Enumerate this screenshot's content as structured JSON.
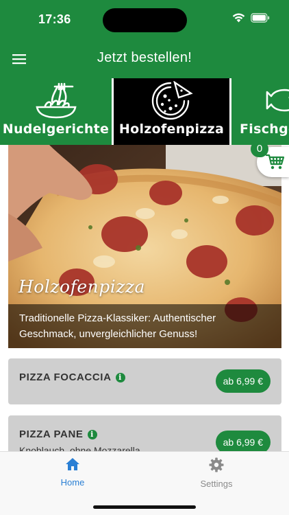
{
  "status_bar": {
    "time": "17:36"
  },
  "header": {
    "title": "Jetzt bestellen!",
    "menu_icon": "hamburger-menu-icon"
  },
  "categories": [
    {
      "label": "Nudelgerichte",
      "icon": "pasta-icon",
      "active": false
    },
    {
      "label": "Holzofenpizza",
      "icon": "pizza-icon",
      "active": true
    },
    {
      "label": "Fischge",
      "icon": "fish-icon",
      "active": false
    }
  ],
  "cart": {
    "count": "0",
    "icon": "shopping-cart-icon"
  },
  "hero": {
    "title": "Holzofenpizza",
    "description": "Traditionelle Pizza-Klassiker: Authentischer Geschmack, unvergleichlicher Genuss!"
  },
  "products": [
    {
      "name": "PIZZA FOCACCIA",
      "description": "",
      "price": "ab 6,99 €"
    },
    {
      "name": "PIZZA PANE",
      "description": "Knoblauch, ohne Mozzarella",
      "price": "ab 6,99 €"
    }
  ],
  "tabbar": {
    "home": {
      "label": "Home",
      "icon": "home-icon"
    },
    "settings": {
      "label": "Settings",
      "icon": "gear-icon"
    }
  },
  "colors": {
    "brand_green": "#1e8a3e",
    "active_tab": "#2a7fd4",
    "card_bg": "#cfcfcf"
  }
}
